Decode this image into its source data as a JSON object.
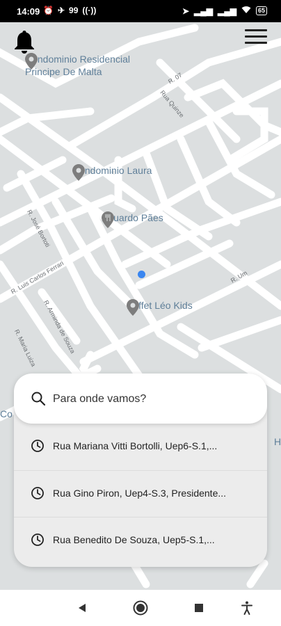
{
  "status_bar": {
    "time": "14:09",
    "left_indicators": [
      "⏰",
      "✈",
      "99",
      "((·))"
    ],
    "right_indicators": [
      "➤",
      "▂▄▆",
      "▂▄▆"
    ],
    "battery": "65"
  },
  "map": {
    "pois": [
      {
        "name_line1": "Condominio Residencial",
        "name_line2": "Principe De Malta",
        "icon": "map-pin-icon"
      },
      {
        "name": "Condominio Laura",
        "icon": "map-pin-icon"
      },
      {
        "name": "Eduardo Pães",
        "icon": "restaurant-pin-icon"
      },
      {
        "name": "Buffet Léo Kids",
        "icon": "map-pin-icon"
      }
    ],
    "streets": [
      "R. 07",
      "Rua Quinze",
      "R. José Bortoti",
      "R. Luis Carlos Ferrari",
      "R. Arminda de Souza",
      "R. Maria Luiza",
      "R. Um"
    ],
    "edge_labels": [
      "Co",
      "H"
    ]
  },
  "top_controls": {
    "notifications_icon": "bell-icon",
    "menu_icon": "hamburger-menu-icon"
  },
  "search_panel": {
    "placeholder": "Para onde vamos?",
    "recent_destinations": [
      {
        "label": "Rua Mariana Vitti Bortolli, Uep6-S.1,...",
        "icon": "clock-icon"
      },
      {
        "label": "Rua Gino Piron, Uep4-S.3, Presidente...",
        "icon": "clock-icon"
      },
      {
        "label": "Rua Benedito De Souza, Uep5-S.1,...",
        "icon": "clock-icon"
      }
    ]
  },
  "nav_bar": {
    "buttons": [
      "back-icon",
      "home-icon",
      "recents-icon",
      "accessibility-icon"
    ]
  },
  "colors": {
    "map_background": "#dcdfe0",
    "road": "#ffffff",
    "poi_text": "#5f7f99",
    "location_dot": "#3a86f0"
  }
}
